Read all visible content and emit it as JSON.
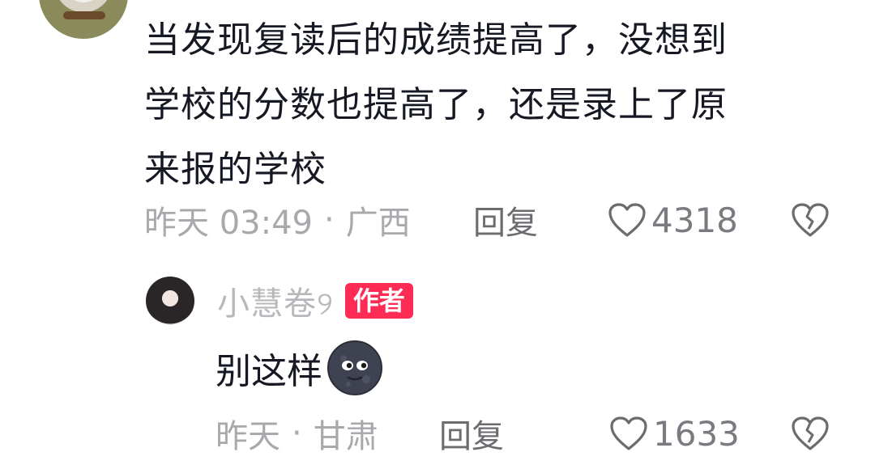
{
  "comment": {
    "text_lines": [
      "当发现复读后的成绩提高了，没想到",
      "学校的分数也提高了，还是录上了原",
      "来报的学校"
    ],
    "time": "昨天 03:49",
    "separator": "·",
    "location": "广西",
    "reply_label": "回复",
    "like_count": "4318"
  },
  "reply": {
    "author_name": "小慧卷୨",
    "author_badge": "作者",
    "text": "别这样",
    "emoji": "new-moon-face",
    "time": "昨天",
    "separator": "·",
    "location": "甘肃",
    "reply_label": "回复",
    "like_count": "1633"
  },
  "icons": {
    "like": "heart-outline-icon",
    "dislike": "broken-heart-icon"
  },
  "colors": {
    "badge": "#fe2c55",
    "text": "#161823",
    "meta": "#a8a8ad"
  }
}
